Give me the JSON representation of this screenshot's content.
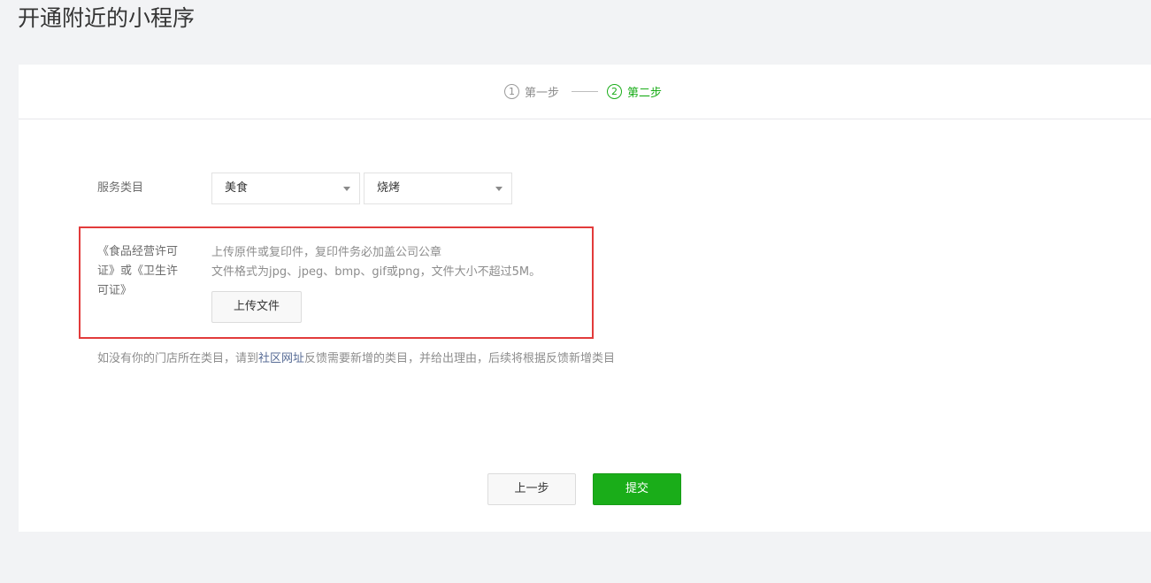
{
  "page": {
    "title": "开通附近的小程序"
  },
  "steps": [
    {
      "num": "1",
      "label": "第一步",
      "state": "done"
    },
    {
      "num": "2",
      "label": "第二步",
      "state": "current"
    }
  ],
  "form": {
    "category_label": "服务类目",
    "category_primary": "美食",
    "category_secondary": "烧烤",
    "license_label": "《食品经营许可证》或《卫生许可证》",
    "license_label_lines": [
      "《食品经营许可",
      "证》或《卫生许",
      "可证》"
    ],
    "upload_tip_1": "上传原件或复印件，复印件务必加盖公司公章",
    "upload_tip_2": "文件格式为jpg、jpeg、bmp、gif或png，文件大小不超过5M。",
    "upload_button": "上传文件"
  },
  "hint": {
    "prefix": "如没有你的门店所在类目，请到",
    "link": "社区网址",
    "suffix": "反馈需要新增的类目，并给出理由，后续将根据反馈新增类目"
  },
  "actions": {
    "prev": "上一步",
    "submit": "提交"
  },
  "colors": {
    "accent": "#1aad19",
    "highlight": "#e23b3b",
    "link": "#576b95"
  }
}
